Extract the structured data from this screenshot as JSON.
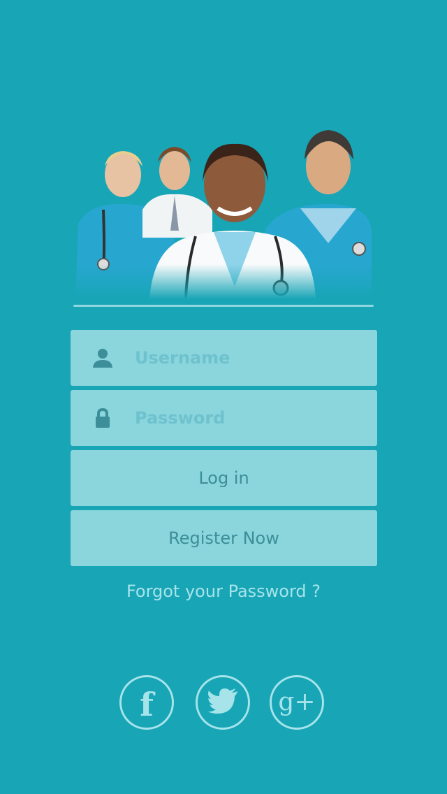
{
  "login_form": {
    "username": {
      "placeholder": "Username",
      "value": ""
    },
    "password": {
      "placeholder": "Password",
      "value": ""
    },
    "login_label": "Log in",
    "register_label": "Register Now",
    "forgot_label": "Forgot your Password ?"
  },
  "social": {
    "facebook": {
      "icon": "facebook-icon",
      "glyph": "f"
    },
    "twitter": {
      "icon": "twitter-bird-icon"
    },
    "googleplus": {
      "icon": "google-plus-icon",
      "glyph": "g+"
    }
  },
  "colors": {
    "background": "#18a5b6",
    "field": "#8bd5dd",
    "light_text": "#a6e4ea",
    "icon": "#3c8e99"
  }
}
